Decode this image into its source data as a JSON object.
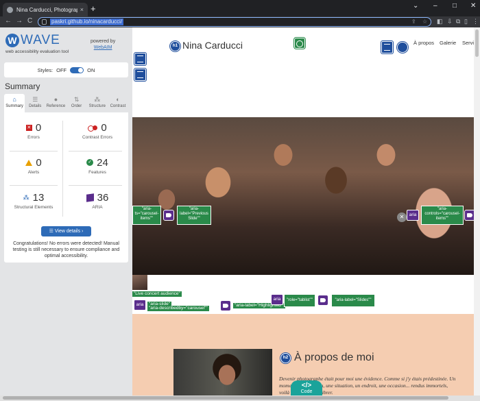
{
  "browser": {
    "tab_title": "Nina Carducci, Photographe pro",
    "tab_close": "×",
    "new_tab": "+",
    "window_controls": [
      "⌄",
      "–",
      "□",
      "✕"
    ],
    "nav_icons": [
      "←",
      "→",
      "C"
    ],
    "url": "paskri.github.io/ninacarducci/",
    "toolbar_icons": [
      "⇪",
      "☆",
      "◧",
      "⇩",
      "⧉",
      "▯",
      "⋮"
    ]
  },
  "wave": {
    "logo_letter": "W",
    "logo_word": "WAVE",
    "tagline": "web accessibility evaluation tool",
    "powered_by": "powered by",
    "webaim": "WebAIM",
    "styles_label": "Styles:",
    "styles_off": "OFF",
    "styles_on": "ON",
    "summary_heading": "Summary",
    "tabs": [
      {
        "label": "Summary",
        "icon": "⌂"
      },
      {
        "label": "Details",
        "icon": "☰"
      },
      {
        "label": "Reference",
        "icon": "●"
      },
      {
        "label": "Order",
        "icon": "⇅"
      },
      {
        "label": "Structure",
        "icon": "⁂"
      },
      {
        "label": "Contrast",
        "icon": "◐"
      }
    ],
    "stats": {
      "errors": {
        "count": "0",
        "label": "Errors"
      },
      "contrast_errors": {
        "count": "0",
        "label": "Contrast Errors"
      },
      "alerts": {
        "count": "0",
        "label": "Alerts"
      },
      "features": {
        "count": "24",
        "label": "Features"
      },
      "structural": {
        "count": "13",
        "label": "Structural Elements"
      },
      "aria": {
        "count": "36",
        "label": "ARIA"
      }
    },
    "details_button": "View details ›",
    "congrats": "Congratulations! No errors were detected! Manual testing is still necessary to ensure compliance and optimal accessibility."
  },
  "page": {
    "h1_badge": "h1",
    "site_name": "Nina Carducci",
    "menu": [
      "À propos",
      "Galerie",
      "Servi"
    ],
    "aria_labels": {
      "carousel_items_left": "\"aria-\nts=\"carousel-\nitems\"\"",
      "previous_slide": "\"aria-\nlabel=\"Previous\nSlide\"\"",
      "carousel_items_right": "\"aria-\ncontrols=\"carousel-\nitems\"\"",
      "live_concert": "\"Live concert audience\"",
      "aria_slide": "\"aria-slide\"",
      "describedby": "\"aria-describedby=\"carousel\"\"",
      "highlighted": "\"aria-label=\"Highlighted\"\"",
      "tablist": "\"role=\"tablist\"\"",
      "slides": "\"aria-label=\"Slides\"\""
    },
    "aria_text": "aria",
    "h2_badge": "h2",
    "about_heading": "À propos de moi",
    "about_text": "Devenir photographe était pour moi une évidence. Comme si j'y étais prédestinée. Un moment, une émotion, une situation, un endroit, une occasion... rendus immortels, voilà ce qui me fait vibrer.",
    "code_glyph": "</>",
    "code_label": "Code"
  }
}
